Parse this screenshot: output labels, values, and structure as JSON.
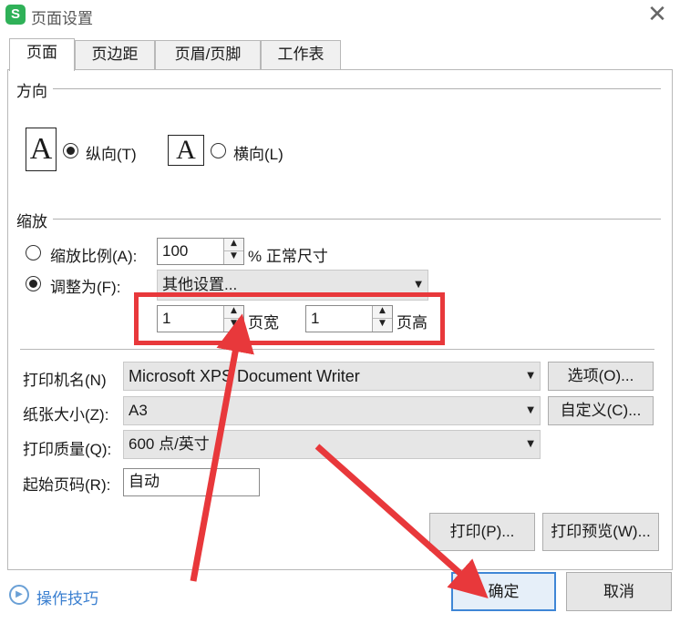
{
  "window": {
    "title": "页面设置",
    "app_icon_letter": "S"
  },
  "tabs": [
    {
      "label": "页面",
      "active": true
    },
    {
      "label": "页边距",
      "active": false
    },
    {
      "label": "页眉/页脚",
      "active": false
    },
    {
      "label": "工作表",
      "active": false
    }
  ],
  "orientation": {
    "group_label": "方向",
    "portrait_label": "纵向(T)",
    "landscape_label": "横向(L)",
    "page_glyph": "A",
    "selected": "portrait"
  },
  "scaling": {
    "group_label": "缩放",
    "scale_label": "缩放比例(A):",
    "scale_value": "100",
    "scale_suffix": "% 正常尺寸",
    "fit_label": "调整为(F):",
    "fit_select": "其他设置...",
    "pages_wide_value": "1",
    "pages_wide_label": "页宽",
    "pages_tall_value": "1",
    "pages_tall_label": "页高",
    "selected": "fit"
  },
  "printer": {
    "name_label": "打印机名(N)",
    "name_value": "Microsoft XPS Document Writer",
    "options_button": "选项(O)...",
    "paper_label": "纸张大小(Z):",
    "paper_value": "A3",
    "custom_button": "自定义(C)...",
    "quality_label": "打印质量(Q):",
    "quality_value": "600 点/英寸",
    "start_page_label": "起始页码(R):",
    "start_page_value": "自动"
  },
  "buttons": {
    "print": "打印(P)...",
    "print_preview": "打印预览(W)...",
    "ok": "确定",
    "cancel": "取消"
  },
  "footer": {
    "tips": "操作技巧"
  },
  "colors": {
    "annotation": "#e8383b",
    "primary_border": "#3f86d6",
    "link": "#3a7fd0"
  }
}
